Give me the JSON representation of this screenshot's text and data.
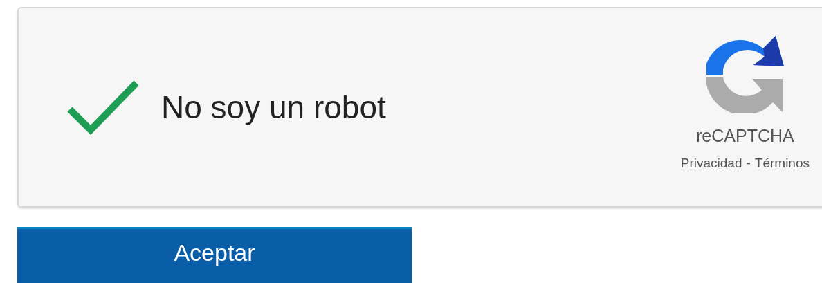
{
  "captcha": {
    "checked": true,
    "label": "No soy un robot",
    "brand": "reCAPTCHA",
    "links": [
      {
        "text": "Privacidad"
      },
      {
        "text": "Términos"
      }
    ],
    "separator": "-"
  },
  "button": {
    "label": "Aceptar"
  }
}
